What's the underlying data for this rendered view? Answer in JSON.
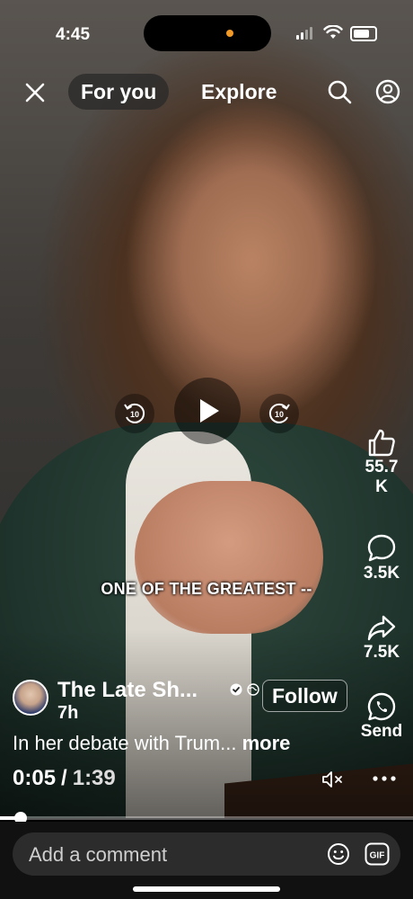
{
  "status_bar": {
    "time": "4:45"
  },
  "nav": {
    "tabs": [
      {
        "label": "For you",
        "active": true
      },
      {
        "label": "Explore",
        "active": false
      }
    ]
  },
  "video": {
    "caption": "ONE OF THE GREATEST --",
    "elapsed": "0:05",
    "separator": "/",
    "total": "1:39",
    "progress_fraction": 0.05
  },
  "actions": {
    "like_count_line1": "55.7",
    "like_count_line2": "K",
    "comment_count": "3.5K",
    "share_count": "7.5K",
    "send_label": "Send"
  },
  "post": {
    "author": "The Late Sh...",
    "posted_ago": "7h",
    "follow_label": "Follow",
    "description": "In her debate with Trum...",
    "more_label": "more"
  },
  "comment": {
    "placeholder": "Add a comment"
  },
  "colors": {
    "island_dot": "#f29a27",
    "comment_bg": "#2c2c2c"
  },
  "icons": [
    "close-icon",
    "search-icon",
    "profile-icon",
    "replay-10-icon",
    "play-icon",
    "forward-10-icon",
    "thumbs-up-icon",
    "comment-bubble-icon",
    "share-arrow-icon",
    "whatsapp-icon",
    "verified-icon",
    "globe-icon",
    "mute-icon",
    "more-dots-icon",
    "emoji-icon",
    "gif-icon"
  ]
}
